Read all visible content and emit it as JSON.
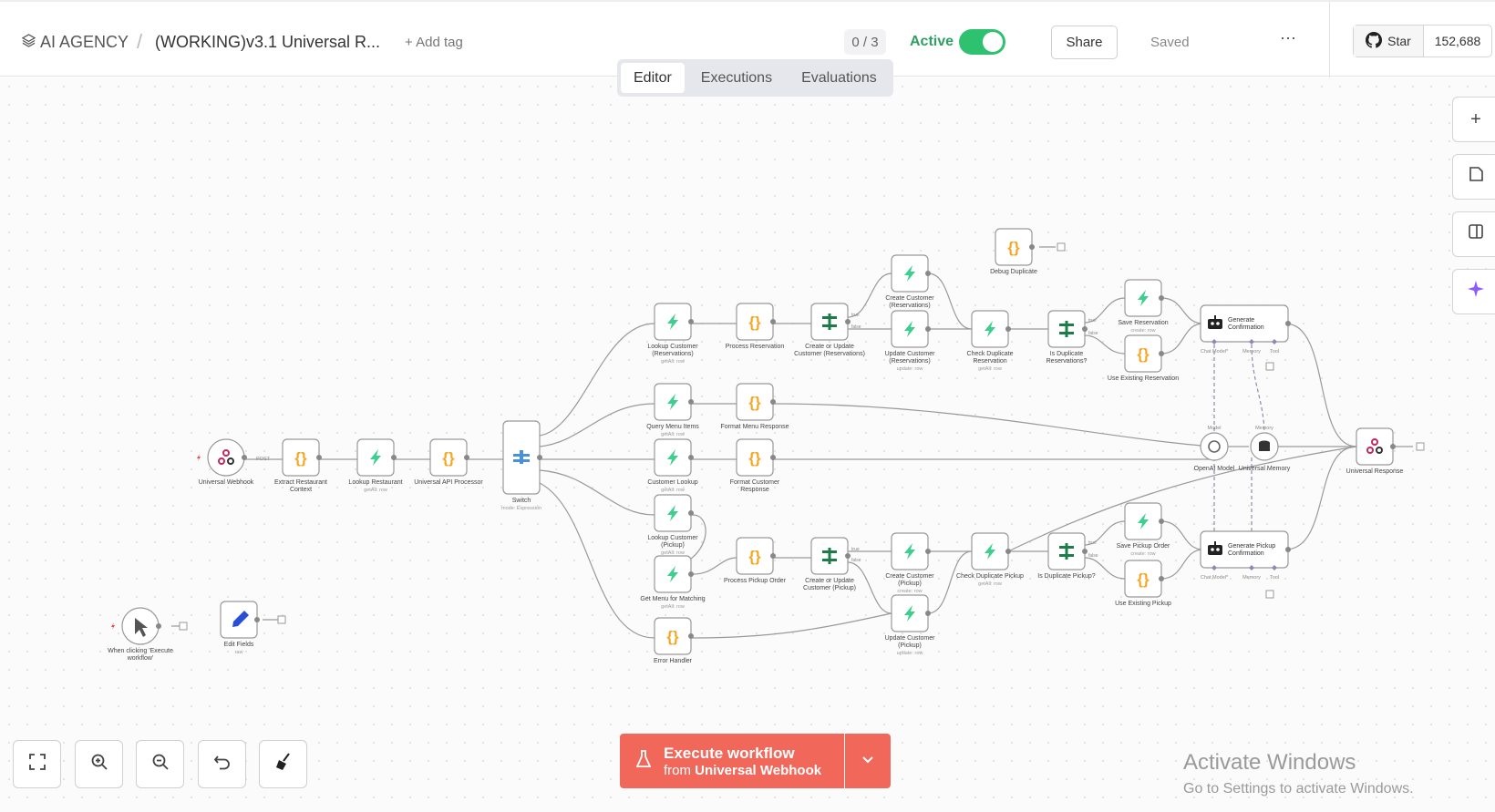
{
  "header": {
    "project": "AI AGENCY",
    "separator": "/",
    "workflow_name": "(WORKING)v3.1 Universal R...",
    "add_tag": "+ Add tag",
    "counter": "0 / 3",
    "active_label": "Active",
    "active": true,
    "share": "Share",
    "saved": "Saved",
    "more": "⋯",
    "github_star": "Star",
    "github_count": "152,688"
  },
  "tabs": [
    "Editor",
    "Executions",
    "Evaluations"
  ],
  "nodes": {
    "universal_webhook": "Universal Webhook",
    "post": "POST",
    "extract_context": [
      "Extract Restaurant",
      "Context"
    ],
    "lookup_restaurant": "Lookup Restaurant",
    "lookup_restaurant_sub": "getAll: row",
    "api_processor": "Universal API Processor",
    "switch": "Switch",
    "switch_sub": "mode: Expression",
    "lookup_customer_res": [
      "Lookup Customer",
      "(Reservations)"
    ],
    "lookup_customer_res_sub": "getAll: row",
    "process_reservation": "Process Reservation",
    "create_update_res": [
      "Create or Update",
      "Customer (Reservations)"
    ],
    "create_customer_res": [
      "Create Customer",
      "(Reservations)"
    ],
    "create_customer_res_sub": "create: row",
    "update_customer_res": [
      "Update Customer",
      "(Reservations)"
    ],
    "update_customer_res_sub": "update: row",
    "check_dup_res": [
      "Check Duplicate",
      "Reservation"
    ],
    "check_dup_res_sub": "getAll: row",
    "is_dup_res": [
      "Is Duplicate",
      "Reservations?"
    ],
    "save_reservation": "Save Reservation",
    "save_reservation_sub": "create: row",
    "use_existing_res": "Use Existing Reservation",
    "debug_duplicate": "Debug Duplicate",
    "gen_confirmation": [
      "Generate",
      "Confirmation"
    ],
    "query_menu": "Query Menu Items",
    "query_menu_sub": "getAll: row",
    "format_menu": "Format Menu Response",
    "customer_lookup": "Customer Lookup",
    "customer_lookup_sub": "getAll: row",
    "format_customer": [
      "Format Customer",
      "Response"
    ],
    "lookup_customer_pickup": [
      "Lookup Customer",
      "(Pickup)"
    ],
    "lookup_customer_pickup_sub": "getAll: row",
    "get_menu_matching": "Get Menu for Matching",
    "get_menu_matching_sub": "getAll: row",
    "process_pickup": "Process Pickup Order",
    "create_update_pickup": [
      "Create or Update",
      "Customer (Pickup)"
    ],
    "create_customer_pickup": [
      "Create Customer",
      "(Pickup)"
    ],
    "create_customer_pickup_sub": "create: row",
    "update_customer_pickup": [
      "Update Customer",
      "(Pickup)"
    ],
    "update_customer_pickup_sub": "update: row",
    "check_dup_pickup": "Check Duplicate Pickup",
    "check_dup_pickup_sub": "getAll: row",
    "is_dup_pickup": "Is Duplicate Pickup?",
    "save_pickup": "Save Pickup Order",
    "save_pickup_sub": "create: row",
    "use_existing_pickup": "Use Existing Pickup",
    "gen_pickup_conf": [
      "Generate Pickup",
      "Confirmation"
    ],
    "error_handler": "Error Handler",
    "openai_model": "OpenAI Model",
    "universal_memory": "Universal Memory",
    "universal_response": "Universal Response",
    "manual_trigger": [
      "When clicking 'Execute",
      "workflow'"
    ],
    "edit_fields": "Edit Fields",
    "edit_fields_sub": "raw",
    "port_chat_model": "Chat Model*",
    "port_memory": "Memory",
    "port_tool": "Tool",
    "port_model": "Model",
    "true": "true",
    "false": "false"
  },
  "execute": {
    "line1": "Execute workflow",
    "line2_prefix": "from ",
    "line2_bold": "Universal Webhook"
  },
  "watermark": {
    "title": "Activate Windows",
    "subtitle": "Go to Settings to activate Windows."
  },
  "colors": {
    "active_green": "#2ec16f",
    "execute_red": "#f1685b",
    "supabase_green": "#3ecf8e",
    "code_orange": "#f5a623",
    "if_green": "#1e7c4a",
    "switch_blue": "#4a90d9"
  }
}
